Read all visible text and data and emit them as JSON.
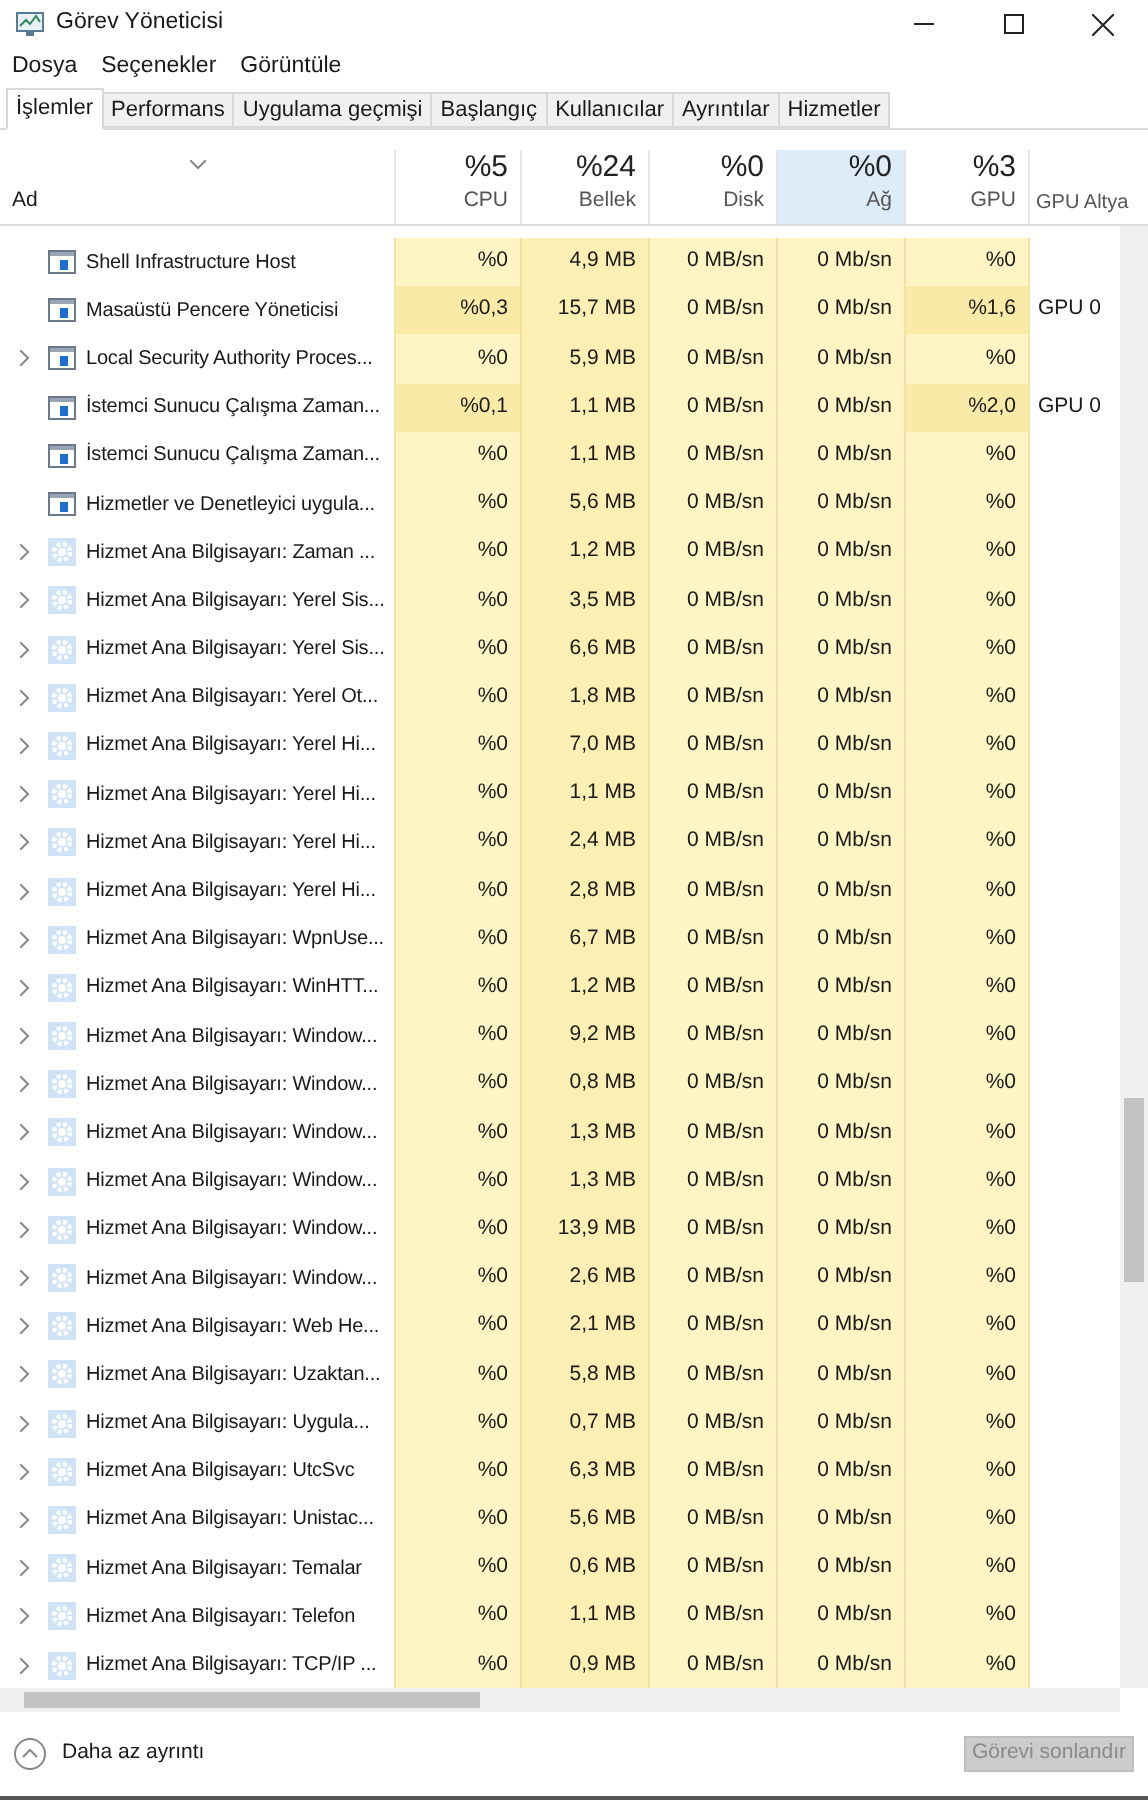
{
  "window": {
    "title": "Görev Yöneticisi"
  },
  "menu": [
    "Dosya",
    "Seçenekler",
    "Görüntüle"
  ],
  "tabs": [
    {
      "label": "İşlemler",
      "selected": true
    },
    {
      "label": "Performans",
      "selected": false
    },
    {
      "label": "Uygulama geçmişi",
      "selected": false
    },
    {
      "label": "Başlangıç",
      "selected": false
    },
    {
      "label": "Kullanıcılar",
      "selected": false
    },
    {
      "label": "Ayrıntılar",
      "selected": false
    },
    {
      "label": "Hizmetler",
      "selected": false
    }
  ],
  "table": {
    "name_column": "Ad",
    "columns": [
      {
        "usage": "%5",
        "label": "CPU",
        "selected": false
      },
      {
        "usage": "%24",
        "label": "Bellek",
        "selected": false
      },
      {
        "usage": "%0",
        "label": "Disk",
        "selected": false
      },
      {
        "usage": "%0",
        "label": "Ağ",
        "selected": true
      },
      {
        "usage": "%3",
        "label": "GPU",
        "selected": false
      },
      {
        "label": "GPU Altya",
        "selected": false
      }
    ],
    "rows": [
      {
        "name": "Shell Infrastructure Host",
        "kind": "app",
        "expandable": false,
        "busy": false,
        "cpu": "%0",
        "memory": "4,9 MB",
        "disk": "0 MB/sn",
        "network": "0 Mb/sn",
        "gpu": "%0"
      },
      {
        "name": "Masaüstü Pencere Yöneticisi",
        "kind": "app",
        "expandable": false,
        "busy": true,
        "cpu": "%0,3",
        "memory": "15,7 MB",
        "disk": "0 MB/sn",
        "network": "0 Mb/sn",
        "gpu": "%1,6",
        "gpu_engine": "GPU 0"
      },
      {
        "name": "Local Security Authority Proces...",
        "kind": "app",
        "expandable": true,
        "busy": false,
        "cpu": "%0",
        "memory": "5,9 MB",
        "disk": "0 MB/sn",
        "network": "0 Mb/sn",
        "gpu": "%0"
      },
      {
        "name": "İstemci Sunucu Çalışma Zaman...",
        "kind": "app",
        "expandable": false,
        "busy": true,
        "cpu": "%0,1",
        "memory": "1,1 MB",
        "disk": "0 MB/sn",
        "network": "0 Mb/sn",
        "gpu": "%2,0",
        "gpu_engine": "GPU 0"
      },
      {
        "name": "İstemci Sunucu Çalışma Zaman...",
        "kind": "app",
        "expandable": false,
        "busy": false,
        "cpu": "%0",
        "memory": "1,1 MB",
        "disk": "0 MB/sn",
        "network": "0 Mb/sn",
        "gpu": "%0"
      },
      {
        "name": "Hizmetler ve Denetleyici uygula...",
        "kind": "app",
        "expandable": false,
        "busy": false,
        "cpu": "%0",
        "memory": "5,6 MB",
        "disk": "0 MB/sn",
        "network": "0 Mb/sn",
        "gpu": "%0"
      },
      {
        "name": "Hizmet Ana Bilgisayarı: Zaman ...",
        "kind": "service",
        "expandable": true,
        "busy": false,
        "cpu": "%0",
        "memory": "1,2 MB",
        "disk": "0 MB/sn",
        "network": "0 Mb/sn",
        "gpu": "%0"
      },
      {
        "name": "Hizmet Ana Bilgisayarı: Yerel Sis...",
        "kind": "service",
        "expandable": true,
        "busy": false,
        "cpu": "%0",
        "memory": "3,5 MB",
        "disk": "0 MB/sn",
        "network": "0 Mb/sn",
        "gpu": "%0"
      },
      {
        "name": "Hizmet Ana Bilgisayarı: Yerel Sis...",
        "kind": "service",
        "expandable": true,
        "busy": false,
        "cpu": "%0",
        "memory": "6,6 MB",
        "disk": "0 MB/sn",
        "network": "0 Mb/sn",
        "gpu": "%0"
      },
      {
        "name": "Hizmet Ana Bilgisayarı: Yerel Ot...",
        "kind": "service",
        "expandable": true,
        "busy": false,
        "cpu": "%0",
        "memory": "1,8 MB",
        "disk": "0 MB/sn",
        "network": "0 Mb/sn",
        "gpu": "%0"
      },
      {
        "name": "Hizmet Ana Bilgisayarı: Yerel Hi...",
        "kind": "service",
        "expandable": true,
        "busy": false,
        "cpu": "%0",
        "memory": "7,0 MB",
        "disk": "0 MB/sn",
        "network": "0 Mb/sn",
        "gpu": "%0"
      },
      {
        "name": "Hizmet Ana Bilgisayarı: Yerel Hi...",
        "kind": "service",
        "expandable": true,
        "busy": false,
        "cpu": "%0",
        "memory": "1,1 MB",
        "disk": "0 MB/sn",
        "network": "0 Mb/sn",
        "gpu": "%0"
      },
      {
        "name": "Hizmet Ana Bilgisayarı: Yerel Hi...",
        "kind": "service",
        "expandable": true,
        "busy": false,
        "cpu": "%0",
        "memory": "2,4 MB",
        "disk": "0 MB/sn",
        "network": "0 Mb/sn",
        "gpu": "%0"
      },
      {
        "name": "Hizmet Ana Bilgisayarı: Yerel Hi...",
        "kind": "service",
        "expandable": true,
        "busy": false,
        "cpu": "%0",
        "memory": "2,8 MB",
        "disk": "0 MB/sn",
        "network": "0 Mb/sn",
        "gpu": "%0"
      },
      {
        "name": "Hizmet Ana Bilgisayarı: WpnUse...",
        "kind": "service",
        "expandable": true,
        "busy": false,
        "cpu": "%0",
        "memory": "6,7 MB",
        "disk": "0 MB/sn",
        "network": "0 Mb/sn",
        "gpu": "%0"
      },
      {
        "name": "Hizmet Ana Bilgisayarı: WinHTT...",
        "kind": "service",
        "expandable": true,
        "busy": false,
        "cpu": "%0",
        "memory": "1,2 MB",
        "disk": "0 MB/sn",
        "network": "0 Mb/sn",
        "gpu": "%0"
      },
      {
        "name": "Hizmet Ana Bilgisayarı: Window...",
        "kind": "service",
        "expandable": true,
        "busy": false,
        "cpu": "%0",
        "memory": "9,2 MB",
        "disk": "0 MB/sn",
        "network": "0 Mb/sn",
        "gpu": "%0"
      },
      {
        "name": "Hizmet Ana Bilgisayarı: Window...",
        "kind": "service",
        "expandable": true,
        "busy": false,
        "cpu": "%0",
        "memory": "0,8 MB",
        "disk": "0 MB/sn",
        "network": "0 Mb/sn",
        "gpu": "%0"
      },
      {
        "name": "Hizmet Ana Bilgisayarı: Window...",
        "kind": "service",
        "expandable": true,
        "busy": false,
        "cpu": "%0",
        "memory": "1,3 MB",
        "disk": "0 MB/sn",
        "network": "0 Mb/sn",
        "gpu": "%0"
      },
      {
        "name": "Hizmet Ana Bilgisayarı: Window...",
        "kind": "service",
        "expandable": true,
        "busy": false,
        "cpu": "%0",
        "memory": "1,3 MB",
        "disk": "0 MB/sn",
        "network": "0 Mb/sn",
        "gpu": "%0"
      },
      {
        "name": "Hizmet Ana Bilgisayarı: Window...",
        "kind": "service",
        "expandable": true,
        "busy": false,
        "cpu": "%0",
        "memory": "13,9 MB",
        "disk": "0 MB/sn",
        "network": "0 Mb/sn",
        "gpu": "%0"
      },
      {
        "name": "Hizmet Ana Bilgisayarı: Window...",
        "kind": "service",
        "expandable": true,
        "busy": false,
        "cpu": "%0",
        "memory": "2,6 MB",
        "disk": "0 MB/sn",
        "network": "0 Mb/sn",
        "gpu": "%0"
      },
      {
        "name": "Hizmet Ana Bilgisayarı: Web He...",
        "kind": "service",
        "expandable": true,
        "busy": false,
        "cpu": "%0",
        "memory": "2,1 MB",
        "disk": "0 MB/sn",
        "network": "0 Mb/sn",
        "gpu": "%0"
      },
      {
        "name": "Hizmet Ana Bilgisayarı: Uzaktan...",
        "kind": "service",
        "expandable": true,
        "busy": false,
        "cpu": "%0",
        "memory": "5,8 MB",
        "disk": "0 MB/sn",
        "network": "0 Mb/sn",
        "gpu": "%0"
      },
      {
        "name": "Hizmet Ana Bilgisayarı: Uygula...",
        "kind": "service",
        "expandable": true,
        "busy": false,
        "cpu": "%0",
        "memory": "0,7 MB",
        "disk": "0 MB/sn",
        "network": "0 Mb/sn",
        "gpu": "%0"
      },
      {
        "name": "Hizmet Ana Bilgisayarı: UtcSvc",
        "kind": "service",
        "expandable": true,
        "busy": false,
        "cpu": "%0",
        "memory": "6,3 MB",
        "disk": "0 MB/sn",
        "network": "0 Mb/sn",
        "gpu": "%0"
      },
      {
        "name": "Hizmet Ana Bilgisayarı: Unistac...",
        "kind": "service",
        "expandable": true,
        "busy": false,
        "cpu": "%0",
        "memory": "5,6 MB",
        "disk": "0 MB/sn",
        "network": "0 Mb/sn",
        "gpu": "%0"
      },
      {
        "name": "Hizmet Ana Bilgisayarı: Temalar",
        "kind": "service",
        "expandable": true,
        "busy": false,
        "cpu": "%0",
        "memory": "0,6 MB",
        "disk": "0 MB/sn",
        "network": "0 Mb/sn",
        "gpu": "%0"
      },
      {
        "name": "Hizmet Ana Bilgisayarı: Telefon",
        "kind": "service",
        "expandable": true,
        "busy": false,
        "cpu": "%0",
        "memory": "1,1 MB",
        "disk": "0 MB/sn",
        "network": "0 Mb/sn",
        "gpu": "%0"
      },
      {
        "name": "Hizmet Ana Bilgisayarı: TCP/IP ...",
        "kind": "service",
        "expandable": true,
        "busy": false,
        "cpu": "%0",
        "memory": "0,9 MB",
        "disk": "0 MB/sn",
        "network": "0 Mb/sn",
        "gpu": "%0"
      }
    ]
  },
  "footer": {
    "details_link": "Daha az ayrıntı",
    "end_task": {
      "label": "Görevi sonlandır",
      "disabled": true
    }
  }
}
